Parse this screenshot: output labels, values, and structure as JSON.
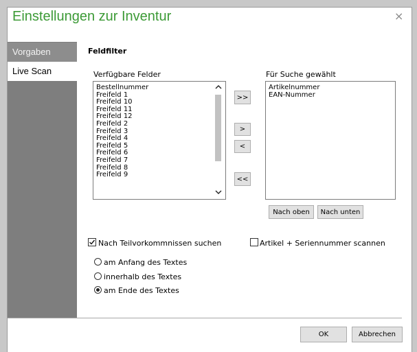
{
  "dialog": {
    "title": "Einstellungen zur Inventur",
    "close_icon": "×"
  },
  "nav": {
    "items": [
      {
        "label": "Vorgaben"
      },
      {
        "label": "Live Scan"
      }
    ]
  },
  "section_title": "Feldfilter",
  "available": {
    "label": "Verfügbare Felder",
    "items": [
      "Bestellnummer",
      "Freifeld 1",
      "Freifeld 10",
      "Freifeld 11",
      "Freifeld 12",
      "Freifeld 2",
      "Freifeld 3",
      "Freifeld 4",
      "Freifeld 5",
      "Freifeld 6",
      "Freifeld 7",
      "Freifeld 8",
      "Freifeld 9"
    ]
  },
  "selected": {
    "label": "Für Suche gewählt",
    "items": [
      "Artikelnummer",
      "EAN-Nummer"
    ]
  },
  "transfer": {
    "all_right": ">>",
    "right": ">",
    "left": "<",
    "all_left": "<<"
  },
  "order": {
    "up": "Nach oben",
    "down": "Nach unten"
  },
  "options": {
    "partial_label": "Nach Teilvorkommnissen suchen",
    "partial_checked": true,
    "serial_label": "Artikel + Seriennummer scannen",
    "serial_checked": false
  },
  "match": {
    "options": [
      "am Anfang des Textes",
      "innerhalb des Textes",
      "am Ende des Textes"
    ],
    "selected": 2
  },
  "footer": {
    "ok": "OK",
    "cancel": "Abbrechen"
  },
  "icons": {
    "check": "check-icon",
    "close": "close-icon",
    "scroll_up": "chevron-up-icon",
    "scroll_down": "chevron-down-icon"
  }
}
